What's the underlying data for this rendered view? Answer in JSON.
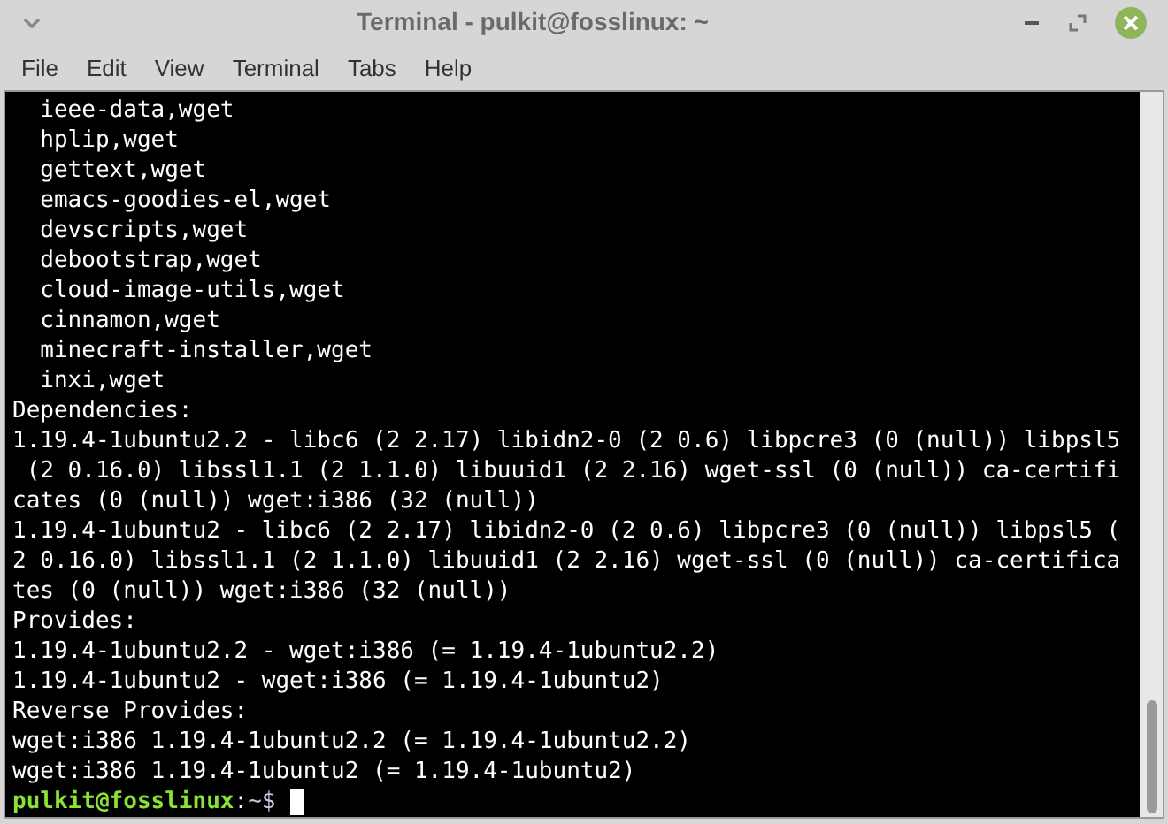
{
  "window": {
    "title": "Terminal - pulkit@fosslinux: ~"
  },
  "menu": [
    "File",
    "Edit",
    "View",
    "Terminal",
    "Tabs",
    "Help"
  ],
  "terminal": {
    "lines": [
      "  ieee-data,wget",
      "  hplip,wget",
      "  gettext,wget",
      "  emacs-goodies-el,wget",
      "  devscripts,wget",
      "  debootstrap,wget",
      "  cloud-image-utils,wget",
      "  cinnamon,wget",
      "  minecraft-installer,wget",
      "  inxi,wget",
      "Dependencies:",
      "1.19.4-1ubuntu2.2 - libc6 (2 2.17) libidn2-0 (2 0.6) libpcre3 (0 (null)) libpsl5",
      " (2 0.16.0) libssl1.1 (2 1.1.0) libuuid1 (2 2.16) wget-ssl (0 (null)) ca-certifi",
      "cates (0 (null)) wget:i386 (32 (null))",
      "1.19.4-1ubuntu2 - libc6 (2 2.17) libidn2-0 (2 0.6) libpcre3 (0 (null)) libpsl5 (",
      "2 0.16.0) libssl1.1 (2 1.1.0) libuuid1 (2 2.16) wget-ssl (0 (null)) ca-certifica",
      "tes (0 (null)) wget:i386 (32 (null))",
      "Provides:",
      "1.19.4-1ubuntu2.2 - wget:i386 (= 1.19.4-1ubuntu2.2)",
      "1.19.4-1ubuntu2 - wget:i386 (= 1.19.4-1ubuntu2)",
      "Reverse Provides:",
      "wget:i386 1.19.4-1ubuntu2.2 (= 1.19.4-1ubuntu2.2)",
      "wget:i386 1.19.4-1ubuntu2 (= 1.19.4-1ubuntu2)"
    ],
    "prompt": {
      "user_host": "pulkit@fosslinux",
      "separator": ":",
      "path": "~",
      "symbol": "$"
    }
  }
}
